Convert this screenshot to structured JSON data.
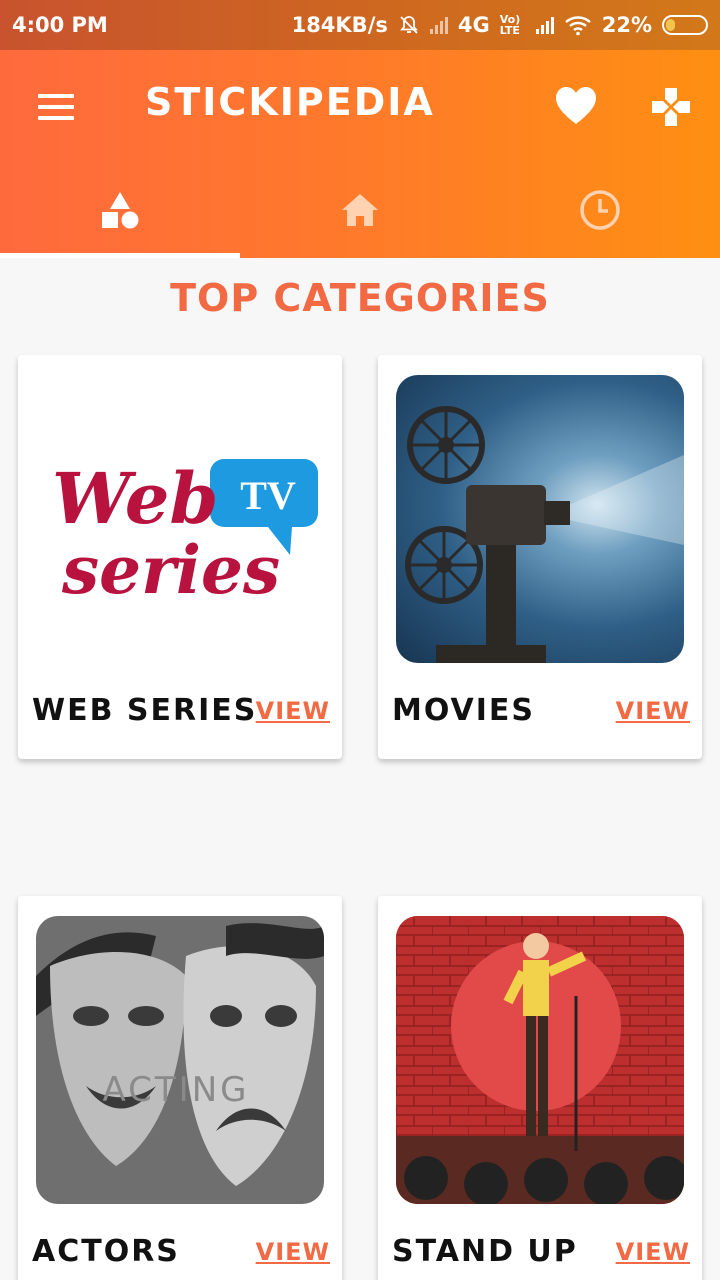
{
  "status_bar": {
    "time": "4:00 PM",
    "speed": "184KB/s",
    "network": "4G",
    "volte": "Vo) LTE",
    "battery": "22%",
    "battery_level": 0.22
  },
  "app_bar": {
    "title": "STICKIPEDIA",
    "icons": [
      "menu-icon",
      "heart-icon",
      "gamepad-icon"
    ],
    "tabs": [
      {
        "icon": "shapes-icon",
        "selected": true
      },
      {
        "icon": "home-icon",
        "selected": false
      },
      {
        "icon": "clock-icon",
        "selected": false
      }
    ]
  },
  "content": {
    "section_title": "TOP CATEGORIES",
    "categories": [
      {
        "label": "WEB SERIES",
        "action": "VIEW",
        "thumb_text_1": "Web",
        "thumb_text_2": "series",
        "thumb_badge": "TV"
      },
      {
        "label": "MOVIES",
        "action": "VIEW"
      },
      {
        "label": "ACTORS",
        "action": "VIEW",
        "thumb_text": "ACTING"
      },
      {
        "label": "STAND UP",
        "action": "VIEW"
      }
    ]
  },
  "colors": {
    "accent": "#f26a43",
    "header_start": "#ff6a3d",
    "header_end": "#ff8f12"
  }
}
